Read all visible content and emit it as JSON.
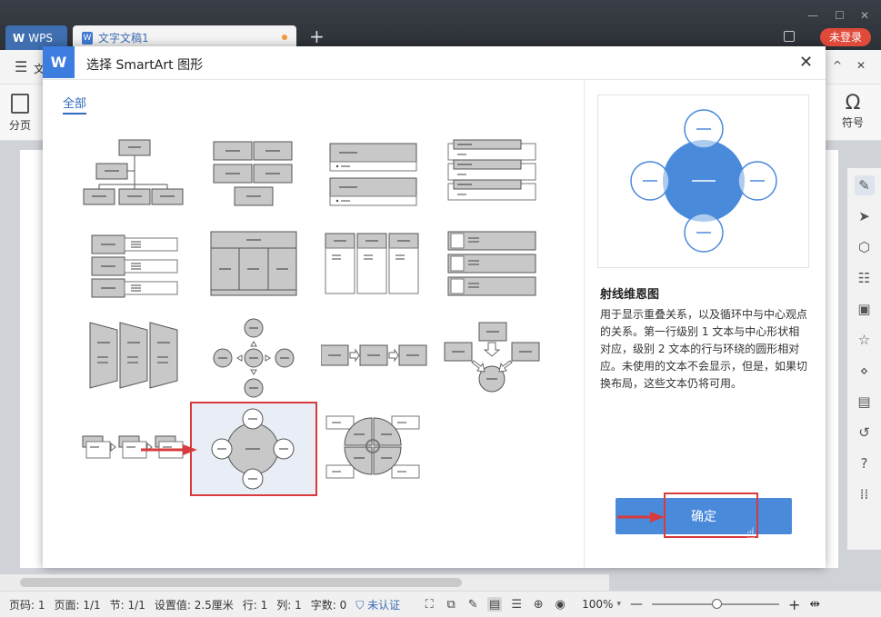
{
  "window": {
    "tab_wps": "WPS",
    "tab_doc": "文字文稿1",
    "login": "未登录"
  },
  "ribbon": {
    "menu_fragment": "文",
    "page_break": "分页",
    "symbol": "符号"
  },
  "dialog": {
    "title": "选择 SmartArt 图形",
    "category_tab": "全部",
    "preview": {
      "name": "射线维恩图",
      "description": "用于显示重叠关系，以及循环中与中心观点的关系。第一行级别 1 文本与中心形状相对应，级别 2 文本的行与环绕的圆形相对应。未使用的文本不会显示，但是，如果切换布局，这些文本仍将可用。"
    },
    "ok_label": "确定",
    "layouts": [
      {
        "type": "hierarchy-org",
        "selected": false
      },
      {
        "type": "hierarchy-block",
        "selected": false
      },
      {
        "type": "list-bullets",
        "selected": false
      },
      {
        "type": "list-stacked",
        "selected": false
      },
      {
        "type": "list-side-bullets",
        "selected": false
      },
      {
        "type": "matrix-table",
        "selected": false
      },
      {
        "type": "list-columns",
        "selected": false
      },
      {
        "type": "list-picture",
        "selected": false
      },
      {
        "type": "process-trapezoid",
        "selected": false
      },
      {
        "type": "cycle-radial-arrows",
        "selected": false
      },
      {
        "type": "process-basic",
        "selected": false
      },
      {
        "type": "process-converge",
        "selected": false
      },
      {
        "type": "process-stacked",
        "selected": false
      },
      {
        "type": "radial-venn",
        "selected": true
      },
      {
        "type": "cycle-matrix",
        "selected": false
      }
    ]
  },
  "statusbar": {
    "page": "页码: 1",
    "pages": "页面: 1/1",
    "section": "节: 1/1",
    "setting": "设置值: 2.5厘米",
    "row": "行: 1",
    "col": "列: 1",
    "words": "字数: 0",
    "cert": "未认证",
    "zoom": "100%"
  },
  "colors": {
    "accent": "#4a8adb",
    "highlight": "#d83b3b",
    "title_dark": "#2c3037"
  }
}
